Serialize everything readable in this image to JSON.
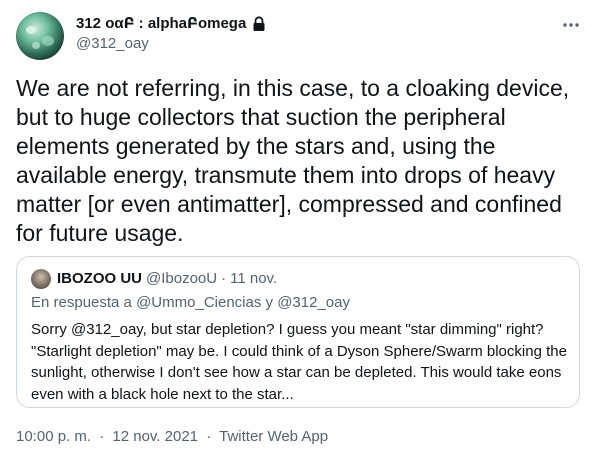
{
  "author": {
    "display_name": "312 οαԲ : alphaԲomega",
    "handle": "@312_oay",
    "avatar_icon": "galaxy-avatar",
    "protected_icon": "lock-icon"
  },
  "more_icon": "more-horizontal-icon",
  "tweet": {
    "text": "We are not referring, in this case, to a cloaking device, but to huge collectors that suction the peripheral elements generated by the stars and, using the available energy, transmute them into drops of heavy matter [or even antimatter], compressed and confined for future usage."
  },
  "quoted": {
    "display_name": "IBOZOO UU",
    "handle": "@IbozooU",
    "dot": "·",
    "date": "11 nov.",
    "reply_prefix": "En respuesta a",
    "reply_mention_1": "@Ummo_Ciencias",
    "reply_and": "y",
    "reply_mention_2": "@312_oay",
    "text": "Sorry @312_oay, but star depletion? I guess you meant \"star dimming\" right? \"Starlight depletion\" may be. I could think of a Dyson Sphere/Swarm blocking the sunlight, otherwise I don't see how a star can be depleted. This would take eons even with a black hole next to the star..."
  },
  "meta": {
    "time": "10:00 p. m.",
    "sep": "·",
    "date": "12 nov. 2021",
    "source": "Twitter Web App"
  },
  "colors": {
    "text": "#0f1419",
    "secondary": "#536471",
    "border": "#cfd9de"
  }
}
